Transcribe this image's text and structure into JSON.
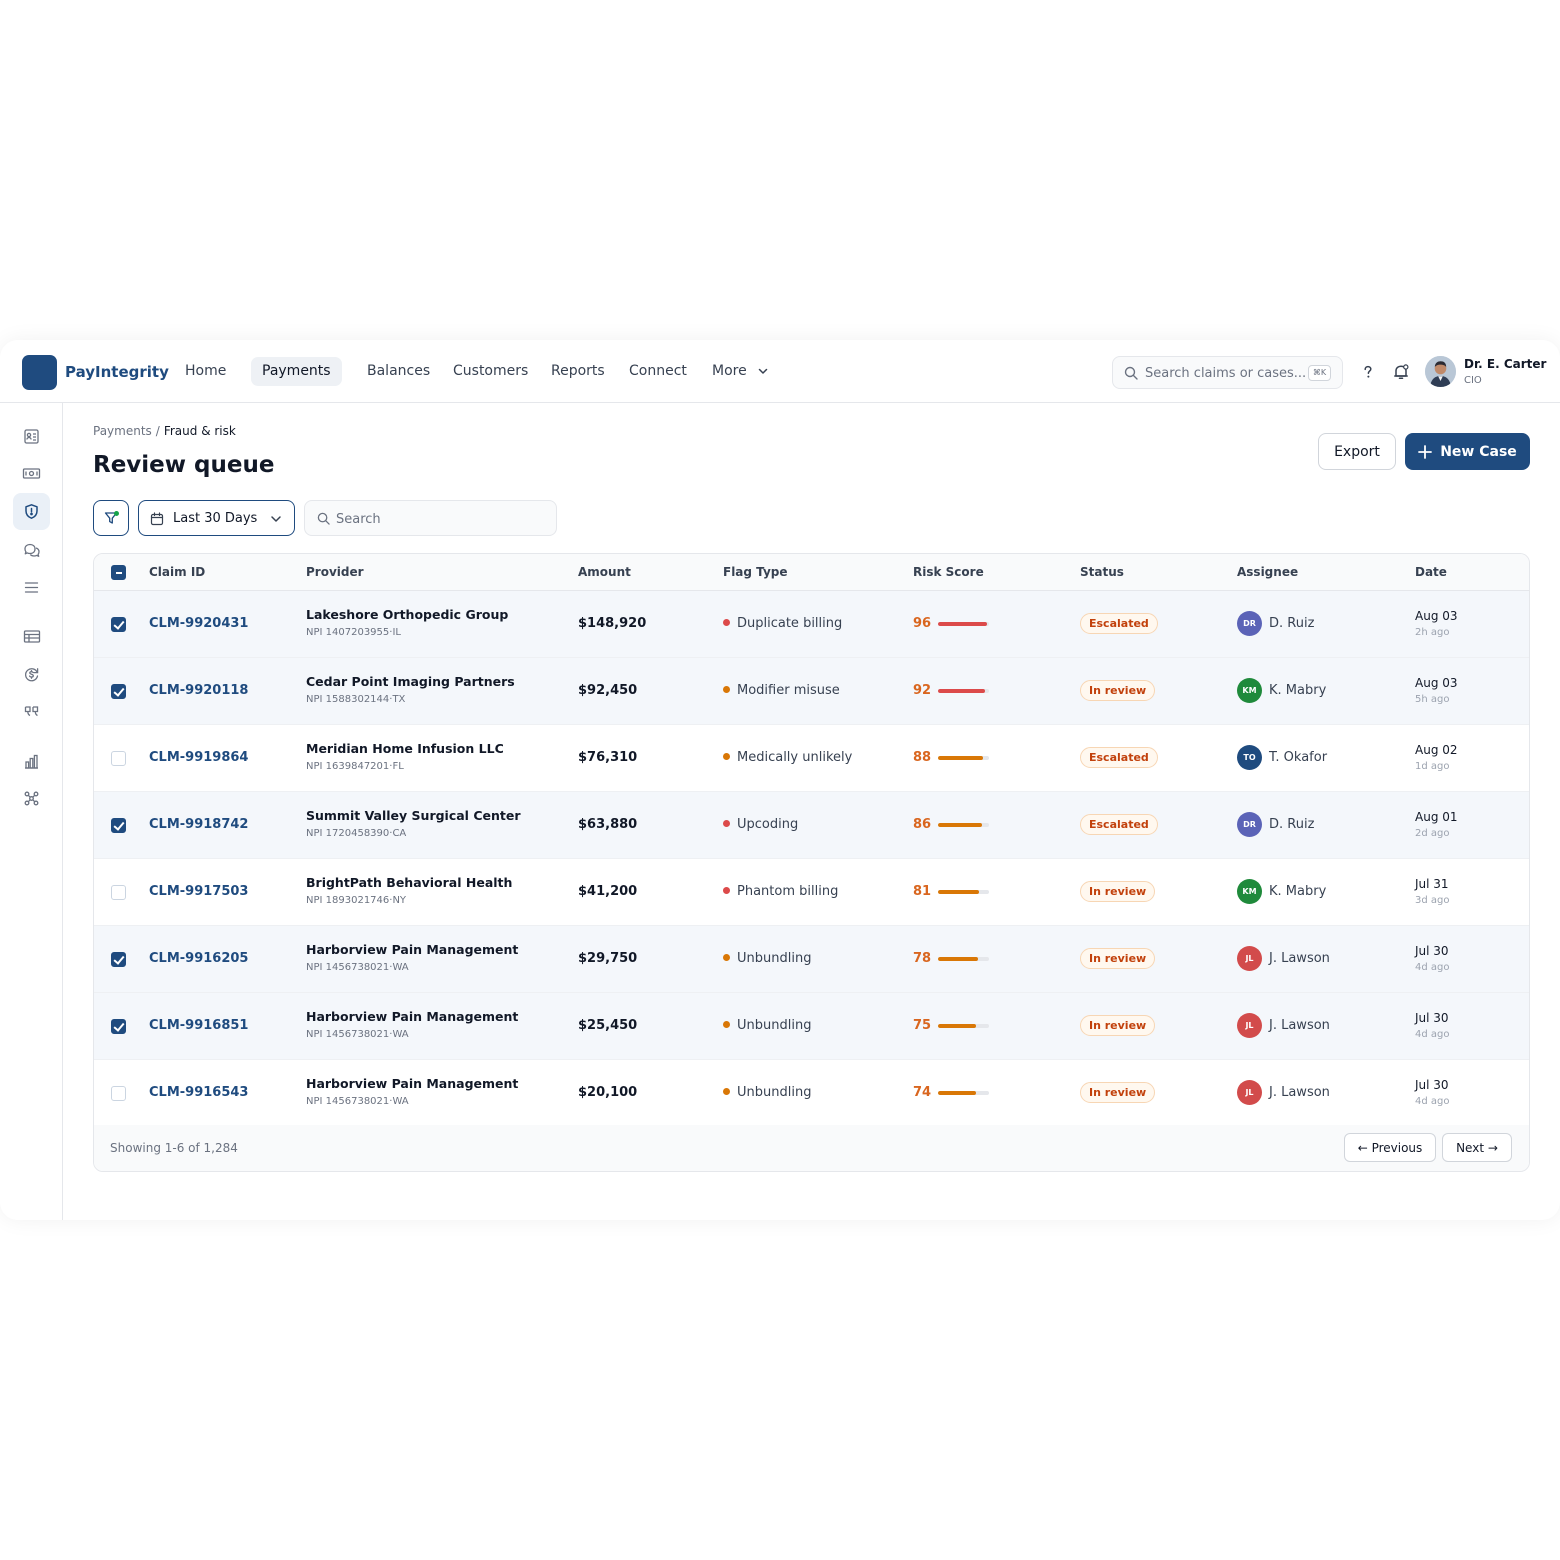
{
  "app": {
    "brand": "PayIntegrity"
  },
  "nav": {
    "items": [
      "Home",
      "Payments",
      "Balances",
      "Customers",
      "Reports",
      "Connect",
      "More"
    ],
    "active": "Payments"
  },
  "header": {
    "search_placeholder": "Search claims or cases...",
    "search_shortcut": "⌘K",
    "user_name": "Dr. E. Carter",
    "user_role": "CIO"
  },
  "sidebar": {
    "icons": [
      "id-card-icon",
      "cash-icon",
      "shield-alert-icon",
      "chat-icon",
      "list-icon",
      "ledger-icon",
      "refresh-dollar-icon",
      "quote-icon",
      "bar-chart-icon",
      "network-icon"
    ],
    "active": "shield-alert-icon"
  },
  "breadcrumb": {
    "parent": "Payments",
    "sep": "/",
    "current": "Fraud & risk"
  },
  "page": {
    "title": "Review queue"
  },
  "actions": {
    "export": "Export",
    "new_case": "New Case"
  },
  "filters": {
    "date_range": "Last 30 Days",
    "search_placeholder": "Search"
  },
  "table": {
    "columns": [
      "Claim ID",
      "Provider",
      "Amount",
      "Flag Type",
      "Risk Score",
      "Status",
      "Assignee",
      "Date"
    ],
    "rows": [
      {
        "selected": true,
        "claim_id": "CLM-9920431",
        "provider": "Lakeshore Orthopedic Group",
        "npi": "NPI 1407203955·IL",
        "amount": "$148,920",
        "flag": "Duplicate billing",
        "flag_color": "#dc4a4a",
        "risk": 96,
        "status": "Escalated",
        "assignee": "D. Ruiz",
        "initials": "DR",
        "avatar_color": "#5b63b7",
        "date": "Aug 03",
        "ago": "2h ago"
      },
      {
        "selected": true,
        "claim_id": "CLM-9920118",
        "provider": "Cedar Point Imaging Partners",
        "npi": "NPI 1588302144·TX",
        "amount": "$92,450",
        "flag": "Modifier misuse",
        "flag_color": "#d97706",
        "risk": 92,
        "status": "In review",
        "assignee": "K. Mabry",
        "initials": "KM",
        "avatar_color": "#1f8a3b",
        "date": "Aug 03",
        "ago": "5h ago"
      },
      {
        "selected": false,
        "claim_id": "CLM-9919864",
        "provider": "Meridian Home Infusion LLC",
        "npi": "NPI 1639847201·FL",
        "amount": "$76,310",
        "flag": "Medically unlikely",
        "flag_color": "#d97706",
        "risk": 88,
        "status": "Escalated",
        "assignee": "T. Okafor",
        "initials": "TO",
        "avatar_color": "#1f4b7f",
        "date": "Aug 02",
        "ago": "1d ago"
      },
      {
        "selected": true,
        "claim_id": "CLM-9918742",
        "provider": "Summit Valley Surgical Center",
        "npi": "NPI 1720458390·CA",
        "amount": "$63,880",
        "flag": "Upcoding",
        "flag_color": "#dc4a4a",
        "risk": 86,
        "status": "Escalated",
        "assignee": "D. Ruiz",
        "initials": "DR",
        "avatar_color": "#5b63b7",
        "date": "Aug 01",
        "ago": "2d ago"
      },
      {
        "selected": false,
        "claim_id": "CLM-9917503",
        "provider": "BrightPath Behavioral Health",
        "npi": "NPI 1893021746·NY",
        "amount": "$41,200",
        "flag": "Phantom billing",
        "flag_color": "#dc4a4a",
        "risk": 81,
        "status": "In review",
        "assignee": "K. Mabry",
        "initials": "KM",
        "avatar_color": "#1f8a3b",
        "date": "Jul 31",
        "ago": "3d ago"
      },
      {
        "selected": true,
        "claim_id": "CLM-9916205",
        "provider": "Harborview Pain Management",
        "npi": "NPI 1456738021·WA",
        "amount": "$29,750",
        "flag": "Unbundling",
        "flag_color": "#d97706",
        "risk": 78,
        "status": "In review",
        "assignee": "J. Lawson",
        "initials": "JL",
        "avatar_color": "#d24b4b",
        "date": "Jul 30",
        "ago": "4d ago"
      },
      {
        "selected": true,
        "claim_id": "CLM-9916851",
        "provider": "Harborview Pain Management",
        "npi": "NPI 1456738021·WA",
        "amount": "$25,450",
        "flag": "Unbundling",
        "flag_color": "#d97706",
        "risk": 75,
        "status": "In review",
        "assignee": "J. Lawson",
        "initials": "JL",
        "avatar_color": "#d24b4b",
        "date": "Jul 30",
        "ago": "4d ago"
      },
      {
        "selected": false,
        "claim_id": "CLM-9916543",
        "provider": "Harborview Pain Management",
        "npi": "NPI 1456738021·WA",
        "amount": "$20,100",
        "flag": "Unbundling",
        "flag_color": "#d97706",
        "risk": 74,
        "status": "In review",
        "assignee": "J. Lawson",
        "initials": "JL",
        "avatar_color": "#d24b4b",
        "date": "Jul 30",
        "ago": "4d ago"
      }
    ],
    "footer": {
      "showing": "Showing 1-6 of 1,284",
      "previous": "← Previous",
      "next": "Next →"
    }
  },
  "colors": {
    "brand": "#1f4b7f",
    "risk_high": "#dc4a4a",
    "risk_med": "#d97706",
    "risk_text": "#d9661f"
  }
}
